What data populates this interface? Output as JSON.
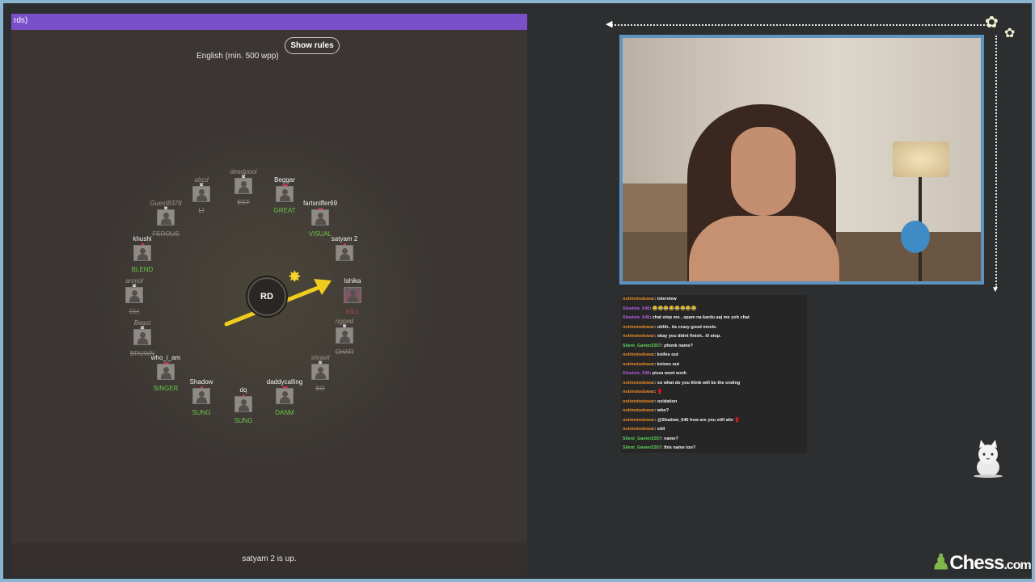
{
  "game": {
    "topbar_text": "rds)",
    "language_label": "English (min. 500 wpp)",
    "show_rules_label": "Show rules",
    "bomb_syllable": "RD",
    "status_text": "satyam 2 is up.",
    "players": [
      {
        "name": "abcd",
        "word": "LI",
        "state": "dead",
        "word_style": "bad"
      },
      {
        "name": "deadpool",
        "word": "EST",
        "state": "dead",
        "word_style": "bad"
      },
      {
        "name": "Beggar",
        "word": "GREAT",
        "state": "alive",
        "word_style": "ok",
        "hearts": "♥♥"
      },
      {
        "name": "fartsniffer69",
        "word": "VISUAL",
        "state": "alive",
        "word_style": "ok",
        "hearts": "♥♥"
      },
      {
        "name": "satyam 2",
        "word": "",
        "state": "alive",
        "word_style": "ok",
        "hearts": "♥"
      },
      {
        "name": "Ishika",
        "word": "KILL",
        "state": "alive",
        "word_style": "ok",
        "hearts": "",
        "photo": true
      },
      {
        "name": "rigged",
        "word": "CHAR",
        "state": "dead",
        "word_style": "bad"
      },
      {
        "name": "shravil",
        "word": "SO",
        "state": "dead",
        "word_style": "bad"
      },
      {
        "name": "daddycalling",
        "word": "DANM",
        "state": "alive",
        "word_style": "ok",
        "hearts": "♥♥"
      },
      {
        "name": "dq",
        "word": "SUNG",
        "state": "alive",
        "word_style": "ok",
        "hearts": "♥"
      },
      {
        "name": "Shadow",
        "word": "SUNG",
        "state": "alive",
        "word_style": "ok",
        "hearts": "♥"
      },
      {
        "name": "who_i_am",
        "word": "SINGER",
        "state": "alive",
        "word_style": "ok",
        "hearts": "♥♥"
      },
      {
        "name": "Beast",
        "word": "BRUWN",
        "state": "dead",
        "word_style": "bad"
      },
      {
        "name": "anmol",
        "word": "CLI",
        "state": "dead",
        "word_style": "bad"
      },
      {
        "name": "khushi",
        "word": "BLEND",
        "state": "alive",
        "word_style": "ok",
        "hearts": "♥"
      },
      {
        "name": "Guest8378",
        "word": "FEROUS",
        "state": "dead",
        "word_style": "bad"
      }
    ]
  },
  "chat": {
    "messages": [
      {
        "user": "notimetodowar",
        "text": "interview",
        "color": "#e98b2a"
      },
      {
        "user": "Shadow_646",
        "text": "😂😂😂😂😂😂😂😂",
        "color": "#b35be0"
      },
      {
        "user": "Shadow_646",
        "text": "chat stop me , spam na kardu aaj me yoh chat",
        "color": "#b35be0"
      },
      {
        "user": "notimetodowar",
        "text": "ohhh.. its crazy good movie.",
        "color": "#e98b2a"
      },
      {
        "user": "notimetodowar",
        "text": "okay you didnt finish.. ill stop.",
        "color": "#e98b2a"
      },
      {
        "user": "Silent_Gamer2357",
        "text": "phonk name?",
        "color": "#5ed45a"
      },
      {
        "user": "notimetodowar",
        "text": "knifes out",
        "color": "#e98b2a"
      },
      {
        "user": "notimetodowar",
        "text": "knives out",
        "color": "#e98b2a"
      },
      {
        "user": "Shadow_646",
        "text": "pizza wont work",
        "color": "#b35be0"
      },
      {
        "user": "notimetodowar",
        "text": "so what do you think will be the ending",
        "color": "#e98b2a"
      },
      {
        "user": "notimetodowar",
        "text": "🥊",
        "color": "#e98b2a"
      },
      {
        "user": "notimetodowar",
        "text": "oxidation",
        "color": "#e98b2a"
      },
      {
        "user": "notimetodowar",
        "text": "who?",
        "color": "#e98b2a"
      },
      {
        "user": "notimetodowar",
        "text": "@Shadow_646 how are you still aliv 🥊",
        "color": "#e98b2a"
      },
      {
        "user": "notimetodowar",
        "text": "still",
        "color": "#e98b2a"
      },
      {
        "user": "Silent_Gamer2357",
        "text": "name?",
        "color": "#5ed45a"
      },
      {
        "user": "Silent_Gamer2357",
        "text": "this name too?",
        "color": "#5ed45a"
      }
    ]
  },
  "brand": {
    "logo_main": "Chess",
    "logo_suffix": ".com",
    "accent": "#81b64c"
  },
  "colors": {
    "topbar": "#7b4fc9",
    "webcam_border": "#5f93bf",
    "frame_border": "#8ab4cf"
  }
}
